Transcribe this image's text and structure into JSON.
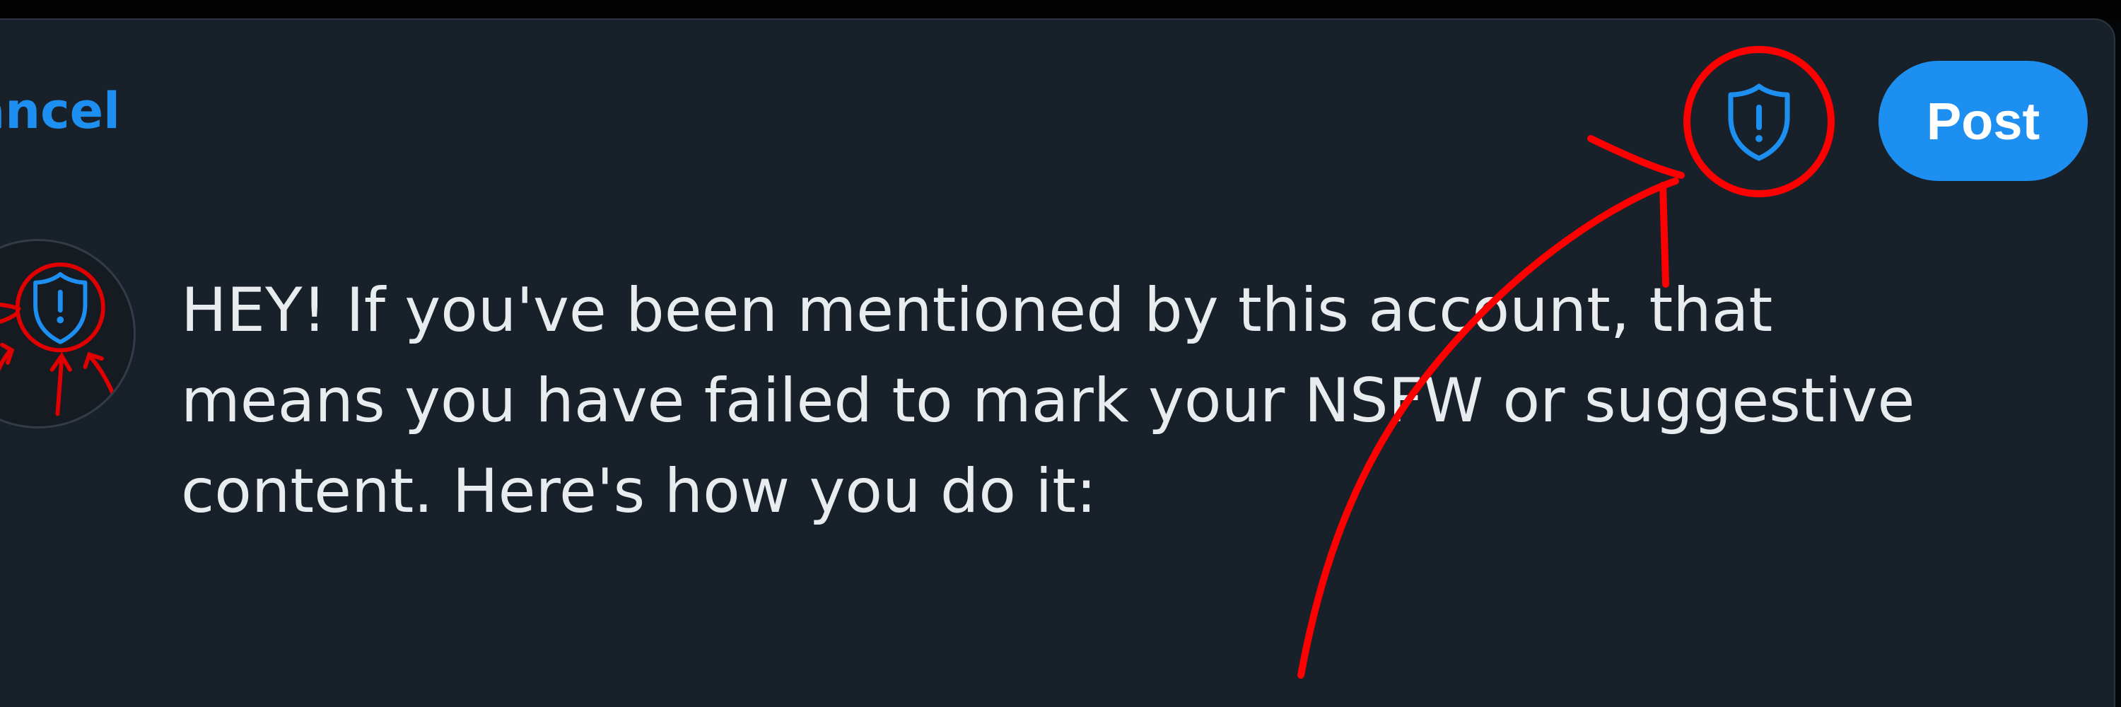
{
  "composer": {
    "cancel_label": "ancel",
    "post_label": "Post",
    "sensitive_icon": "shield-alert-icon",
    "accent_color": "#1d8ff0",
    "background_color": "#18202a"
  },
  "tweet": {
    "text": "HEY! If you've been mentioned by this account, that means you have failed to mark your NSFW or suggestive content. Here's how you do it:"
  },
  "avatar": {
    "icon": "shield-alert-icon"
  },
  "annotation": {
    "color": "#ff0000",
    "highlight_circle": "red-circle",
    "arrow": "red-arrow"
  }
}
